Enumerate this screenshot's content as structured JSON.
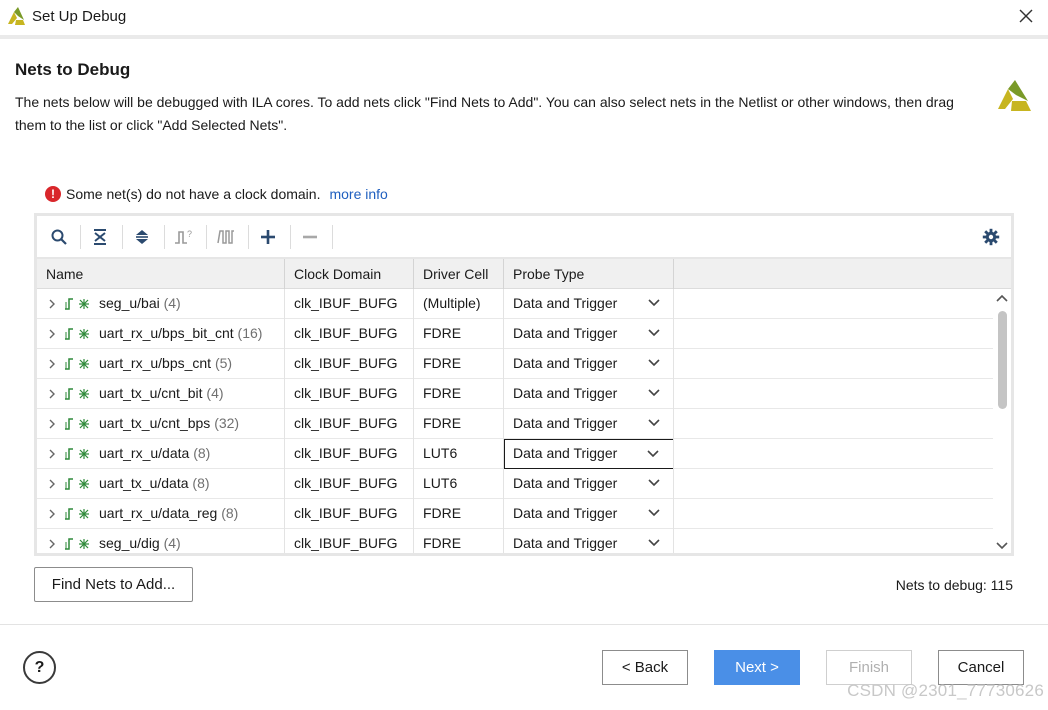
{
  "window": {
    "title": "Set Up Debug",
    "close_icon": "close-icon",
    "logo_icon": "vivado-logo-icon",
    "brand_color": "#c7b520"
  },
  "header": {
    "title": "Nets to Debug",
    "description": "The nets below will be debugged with ILA cores. To add nets click \"Find Nets to Add\". You can also select nets in the Netlist or other windows, then drag them to the list or click \"Add Selected Nets\"."
  },
  "warning": {
    "text": "Some net(s) do not have a clock domain.",
    "link": "more info",
    "icon": "error-icon",
    "color": "#d9262b"
  },
  "toolbar": {
    "icons": [
      "search-icon",
      "collapse-all-icon",
      "expand-all-icon",
      "trigger-icon",
      "waveform-icon",
      "add-icon",
      "remove-icon",
      "gear-icon"
    ]
  },
  "table": {
    "columns": [
      "Name",
      "Clock Domain",
      "Driver Cell",
      "Probe Type"
    ],
    "rows": [
      {
        "name": "seg_u/bai",
        "count": "(4)",
        "clock": "clk_IBUF_BUFG",
        "driver": "(Multiple)",
        "probe": "Data and Trigger"
      },
      {
        "name": "uart_rx_u/bps_bit_cnt",
        "count": "(16)",
        "clock": "clk_IBUF_BUFG",
        "driver": "FDRE",
        "probe": "Data and Trigger"
      },
      {
        "name": "uart_rx_u/bps_cnt",
        "count": "(5)",
        "clock": "clk_IBUF_BUFG",
        "driver": "FDRE",
        "probe": "Data and Trigger"
      },
      {
        "name": "uart_tx_u/cnt_bit",
        "count": "(4)",
        "clock": "clk_IBUF_BUFG",
        "driver": "FDRE",
        "probe": "Data and Trigger"
      },
      {
        "name": "uart_tx_u/cnt_bps",
        "count": "(32)",
        "clock": "clk_IBUF_BUFG",
        "driver": "FDRE",
        "probe": "Data and Trigger"
      },
      {
        "name": "uart_rx_u/data",
        "count": "(8)",
        "clock": "clk_IBUF_BUFG",
        "driver": "LUT6",
        "probe": "Data and Trigger",
        "focused": true
      },
      {
        "name": "uart_tx_u/data",
        "count": "(8)",
        "clock": "clk_IBUF_BUFG",
        "driver": "LUT6",
        "probe": "Data and Trigger"
      },
      {
        "name": "uart_rx_u/data_reg",
        "count": "(8)",
        "clock": "clk_IBUF_BUFG",
        "driver": "FDRE",
        "probe": "Data and Trigger"
      },
      {
        "name": "seg_u/dig",
        "count": "(4)",
        "clock": "clk_IBUF_BUFG",
        "driver": "FDRE",
        "probe": "Data and Trigger"
      }
    ]
  },
  "actions": {
    "find_nets": "Find Nets to Add...",
    "nets_count": "Nets to debug: 115",
    "help": "?",
    "back": "< Back",
    "next": "Next >",
    "finish": "Finish",
    "cancel": "Cancel",
    "next_color": "#4a8fe7"
  },
  "watermark": "CSDN @2301_77730626"
}
